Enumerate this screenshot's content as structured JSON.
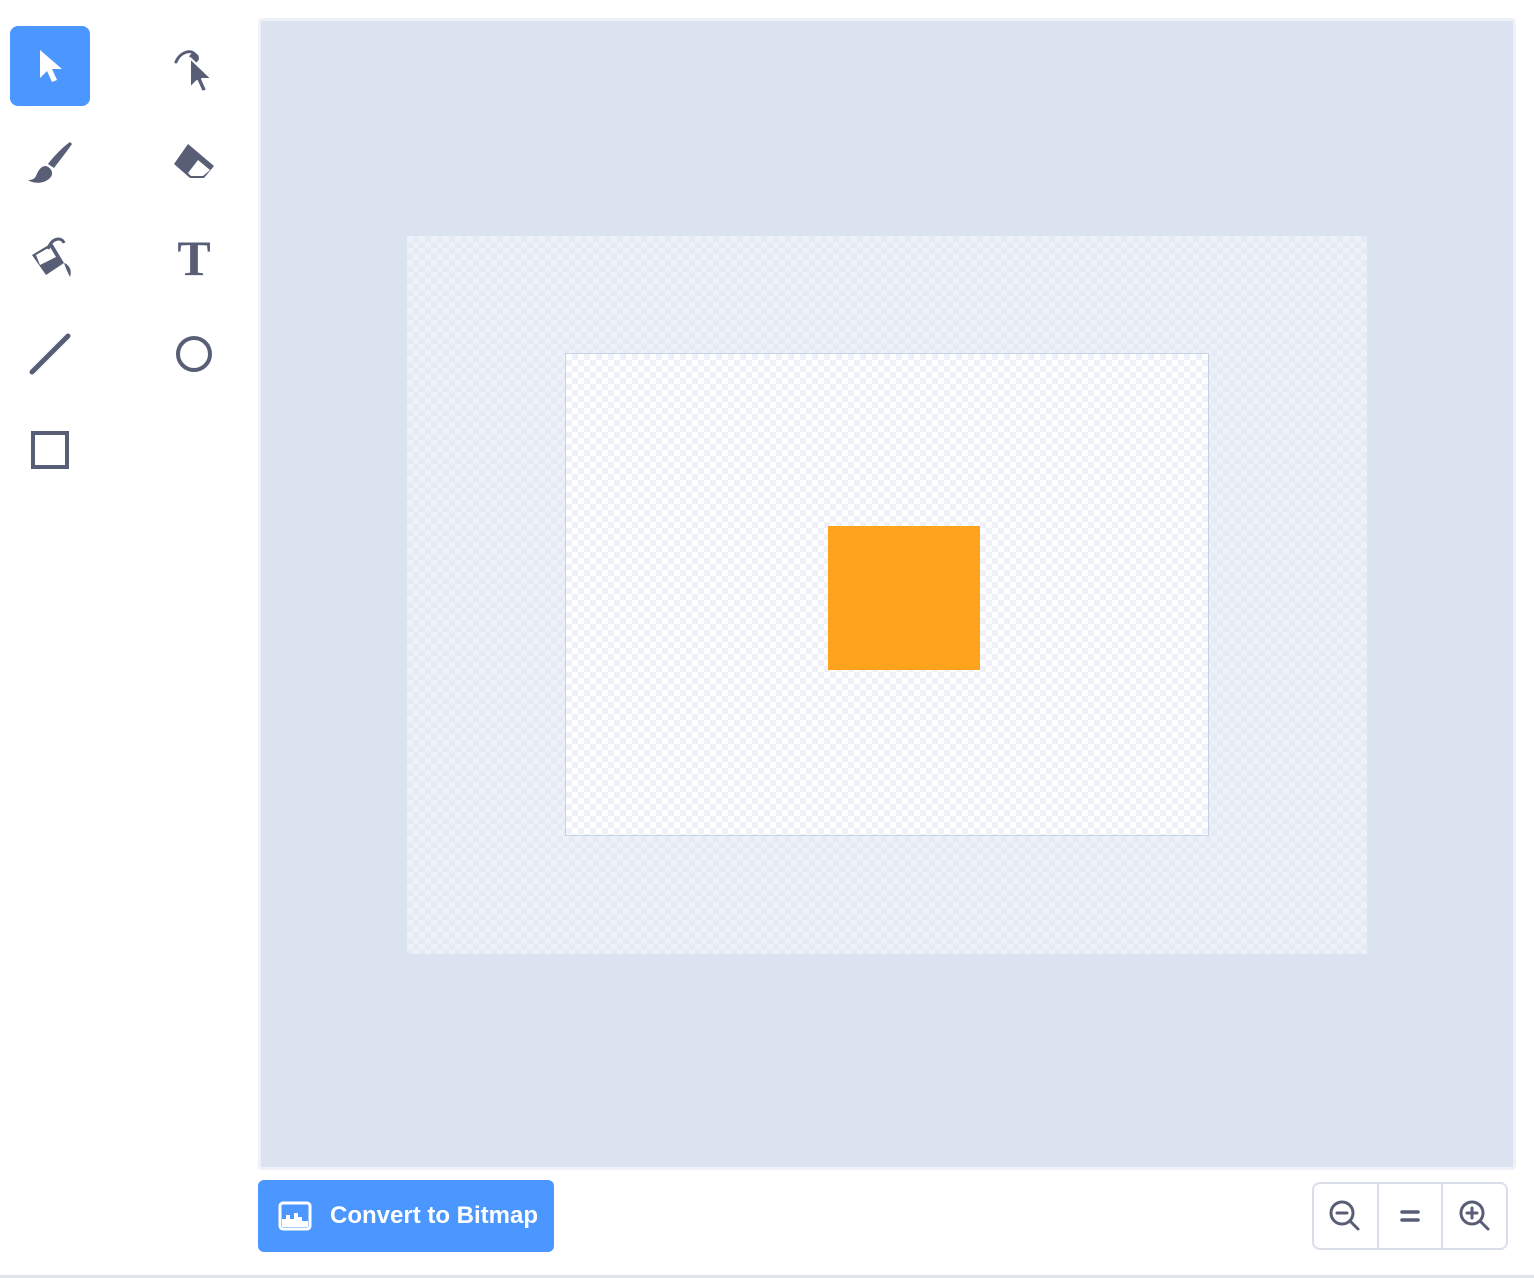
{
  "toolbar": {
    "tools": [
      {
        "name": "select",
        "icon": "select-arrow-icon",
        "selected": true
      },
      {
        "name": "reshape",
        "icon": "reshape-icon",
        "selected": false
      },
      {
        "name": "brush",
        "icon": "brush-icon",
        "selected": false
      },
      {
        "name": "eraser",
        "icon": "eraser-icon",
        "selected": false
      },
      {
        "name": "fill",
        "icon": "fill-bucket-icon",
        "selected": false
      },
      {
        "name": "text",
        "icon": "text-icon",
        "selected": false
      },
      {
        "name": "line",
        "icon": "line-icon",
        "selected": false
      },
      {
        "name": "circle",
        "icon": "circle-icon",
        "selected": false
      },
      {
        "name": "rectangle",
        "icon": "rectangle-icon",
        "selected": false
      }
    ],
    "text_tool_glyph": "T"
  },
  "canvas": {
    "shape_fill": "#FFA31F",
    "frame_color": "#dbe3f0"
  },
  "convert_button": {
    "label": "Convert to Bitmap",
    "icon": "bitmap-image-icon"
  },
  "zoom": {
    "zoom_out_icon": "zoom-out-icon",
    "reset_icon": "zoom-reset-icon",
    "zoom_in_icon": "zoom-in-icon"
  },
  "colors": {
    "accent": "#4C97FF",
    "icon": "#575E75"
  }
}
